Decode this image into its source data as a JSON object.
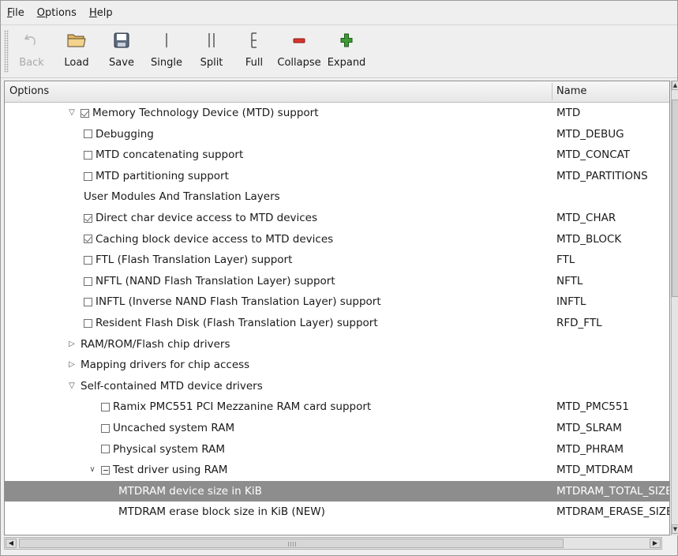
{
  "menu": [
    {
      "label": "File",
      "ul": "F",
      "rest": "ile"
    },
    {
      "label": "Options",
      "ul": "O",
      "rest": "ptions"
    },
    {
      "label": "Help",
      "ul": "H",
      "rest": "elp"
    }
  ],
  "toolbar": {
    "back": "Back",
    "load": "Load",
    "save": "Save",
    "single": "Single",
    "split": "Split",
    "full": "Full",
    "collapse": "Collapse",
    "expand": "Expand"
  },
  "table": {
    "header_options": "Options",
    "header_name": "Name"
  },
  "rows": [
    {
      "label": "Memory Technology Device (MTD) support",
      "name": "MTD"
    },
    {
      "label": "Debugging",
      "name": "MTD_DEBUG"
    },
    {
      "label": "MTD concatenating support",
      "name": "MTD_CONCAT"
    },
    {
      "label": "MTD partitioning support",
      "name": "MTD_PARTITIONS"
    },
    {
      "label": "User Modules And Translation Layers",
      "name": ""
    },
    {
      "label": "Direct char device access to MTD devices",
      "name": "MTD_CHAR"
    },
    {
      "label": "Caching block device access to MTD devices",
      "name": "MTD_BLOCK"
    },
    {
      "label": "FTL (Flash Translation Layer) support",
      "name": "FTL"
    },
    {
      "label": "NFTL (NAND Flash Translation Layer) support",
      "name": "NFTL"
    },
    {
      "label": "INFTL (Inverse NAND Flash Translation Layer) support",
      "name": "INFTL"
    },
    {
      "label": "Resident Flash Disk (Flash Translation Layer) support",
      "name": "RFD_FTL"
    },
    {
      "label": "RAM/ROM/Flash chip drivers",
      "name": ""
    },
    {
      "label": "Mapping drivers for chip access",
      "name": ""
    },
    {
      "label": "Self-contained MTD device drivers",
      "name": ""
    },
    {
      "label": "Ramix PMC551 PCI Mezzanine RAM card support",
      "name": "MTD_PMC551"
    },
    {
      "label": "Uncached system RAM",
      "name": "MTD_SLRAM"
    },
    {
      "label": "Physical system RAM",
      "name": "MTD_PHRAM"
    },
    {
      "label": "Test driver using RAM",
      "name": "MTD_MTDRAM"
    },
    {
      "label": "MTDRAM device size in KiB",
      "name": "MTDRAM_TOTAL_SIZE"
    },
    {
      "label": "MTDRAM erase block size in KiB (NEW)",
      "name": "MTDRAM_ERASE_SIZE"
    }
  ],
  "colors": {
    "selected_row": "#8d8d8d",
    "collapse_icon": "#d9342b",
    "expand_icon": "#3d9b35"
  }
}
